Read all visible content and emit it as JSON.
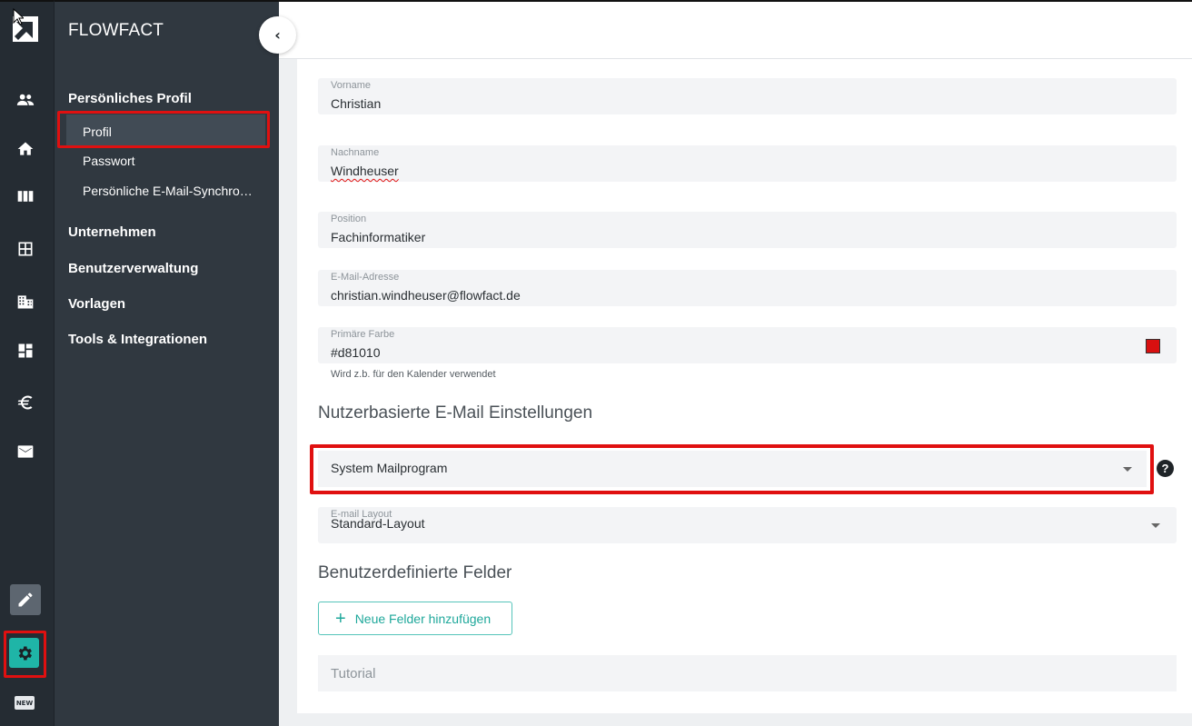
{
  "app": {
    "brand": "FLOWFACT"
  },
  "rail": {
    "icons": [
      "logo-icon",
      "contacts-icon",
      "home-icon",
      "columns-icon",
      "grid-icon",
      "building-icon",
      "dashboard-icon",
      "euro-icon",
      "mail-icon",
      "edit-icon",
      "gear-icon",
      "new-badge-icon"
    ],
    "new_badge": "NEW",
    "accent": "#1fb5a7"
  },
  "nav": {
    "sections": [
      {
        "label": "Persönliches Profil",
        "items": [
          "Profil",
          "Passwort",
          "Persönliche E-Mail-Synchro…"
        ]
      },
      {
        "label": "Unternehmen"
      },
      {
        "label": "Benutzerverwaltung"
      },
      {
        "label": "Vorlagen"
      },
      {
        "label": "Tools & Integrationen"
      }
    ],
    "active_item": "Profil",
    "collapse_icon": "chevron-left-icon"
  },
  "form": {
    "fields": [
      {
        "label": "Vorname",
        "value": "Christian"
      },
      {
        "label": "Nachname",
        "value": "Windheuser"
      },
      {
        "label": "Position",
        "value": "Fachinformatiker"
      },
      {
        "label": "E-Mail-Adresse",
        "value": "christian.windheuser@flowfact.de"
      },
      {
        "label": "Primäre Farbe",
        "value": "#d81010"
      }
    ],
    "color_hint": "Wird z.b. für den Kalender verwendet",
    "primary_color": "#d81010"
  },
  "email_settings": {
    "title": "Nutzerbasierte E-Mail Einstellungen",
    "mail_program": "System Mailprogram",
    "help": "?",
    "layout_label": "E-mail Layout",
    "layout_value": "Standard-Layout"
  },
  "custom_fields": {
    "title": "Benutzerdefinierte Felder",
    "add_button": "Neue Felder hinzufügen",
    "add_icon": "+",
    "tutorial": "Tutorial"
  },
  "highlight_color": "#e01010"
}
